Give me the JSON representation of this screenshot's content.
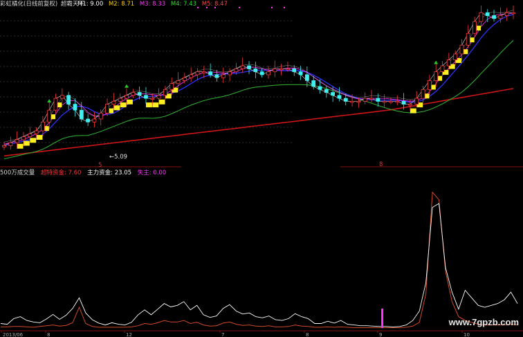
{
  "colors": {
    "background": "#000000",
    "bull_candle": "#ff3b3b",
    "bear_candle": "#3ff0f0",
    "yellow_band": "#ffee20",
    "ma1": "#ffffff",
    "ma2": "#ffd200",
    "ma3": "#ff33ff",
    "ma4": "#33dd33",
    "ma5": "#ff4444",
    "long_ma": "#d01515",
    "mid_ma": "#2fa82f",
    "blue_ma": "#3030ff",
    "capital_main": "#ffffff",
    "capital_super": "#d24a2a",
    "separator": "#8a1010",
    "magenta_bar": "#ff33ff",
    "arrow_icon": "#22cc22"
  },
  "top_panel": {
    "title": "彩虹橘化(日线前复权)",
    "indicator_name": "超霸天下",
    "mas": [
      {
        "label": "M1: 9.00",
        "color": "#ffffff"
      },
      {
        "label": "M2: 8.71",
        "color": "#ffd200"
      },
      {
        "label": "M3: 8.33",
        "color": "#ff33ff"
      },
      {
        "label": "M4: 7.43",
        "color": "#33dd33"
      },
      {
        "label": "M5: 8.47",
        "color": "#ff4444"
      }
    ],
    "low_annotation": "5.09",
    "marker_top": "5",
    "marker_right": "8"
  },
  "bottom_panel": {
    "title": "500万成交量",
    "legend": [
      {
        "label": "超特资金: 7.60",
        "color": "#ff3333"
      },
      {
        "label": "主力资金: 23.05",
        "color": "#ffffff"
      },
      {
        "label": "失主: 0.00",
        "color": "#ff33ff"
      }
    ]
  },
  "x_axis": {
    "labels": [
      "2013/06",
      "8",
      "12",
      "7",
      "8",
      "9",
      "10"
    ]
  },
  "watermark": "www.7gpzb.com",
  "chart_data": [
    {
      "type": "line",
      "title": "",
      "note": "candlestick price panel with moving averages (values estimated, price units)",
      "x": [
        0,
        1,
        2,
        3,
        4,
        5,
        6,
        7,
        8,
        9,
        10,
        11,
        12,
        13,
        14,
        15,
        16,
        17,
        18,
        19,
        20,
        21,
        22,
        23,
        24,
        25,
        26,
        27,
        28,
        29,
        30,
        31,
        32,
        33,
        34,
        35,
        36,
        37,
        38,
        39,
        40,
        41,
        42,
        43,
        44,
        45,
        46,
        47,
        48,
        49,
        50,
        51,
        52,
        53,
        54,
        55,
        56,
        57,
        58,
        59,
        60,
        61,
        62,
        63,
        64,
        65,
        66,
        67,
        68,
        69,
        70,
        71,
        72,
        73,
        74,
        75,
        76,
        77,
        78,
        79
      ],
      "ylim": [
        4.8,
        10.0
      ],
      "series": [
        {
          "name": "M1",
          "values": [
            5.4,
            5.5,
            5.6,
            5.7,
            5.8,
            5.9,
            6.2,
            6.6,
            7.0,
            7.1,
            6.8,
            6.6,
            6.3,
            6.2,
            6.3,
            6.5,
            6.8,
            6.9,
            7.0,
            7.1,
            7.2,
            7.1,
            7.0,
            7.0,
            7.1,
            7.3,
            7.5,
            7.6,
            7.7,
            7.8,
            7.9,
            7.9,
            7.8,
            7.7,
            7.8,
            7.9,
            8.0,
            8.1,
            8.0,
            7.9,
            7.8,
            7.9,
            8.0,
            8.0,
            8.0,
            7.9,
            7.8,
            7.6,
            7.4,
            7.3,
            7.2,
            7.1,
            7.0,
            6.9,
            6.9,
            6.9,
            7.0,
            7.0,
            6.9,
            6.9,
            6.9,
            6.9,
            6.8,
            6.8,
            7.0,
            7.3,
            7.6,
            7.9,
            8.1,
            8.3,
            8.5,
            8.8,
            9.2,
            9.6,
            9.9,
            9.8,
            9.7,
            9.8,
            9.9,
            9.9
          ]
        }
      ]
    },
    {
      "type": "line",
      "title": "",
      "note": "capital flow panel (values estimated)",
      "categories": [
        "2013/06",
        "8",
        "12",
        "7",
        "8",
        "9",
        "10"
      ],
      "ylim": [
        0,
        40
      ],
      "series": [
        {
          "name": "主力资金",
          "values": [
            1.2,
            1.0,
            2.5,
            3.0,
            2.0,
            1.6,
            1.4,
            2.4,
            3.6,
            2.3,
            3.4,
            5.2,
            8.0,
            4.0,
            2.2,
            1.3,
            0.8,
            1.4,
            1.0,
            0.8,
            1.5,
            3.5,
            4.8,
            3.5,
            5.0,
            6.5,
            5.6,
            6.0,
            7.0,
            4.8,
            6.0,
            3.5,
            2.8,
            3.2,
            5.2,
            6.2,
            4.5,
            3.7,
            4.0,
            3.0,
            2.7,
            3.2,
            2.2,
            2.0,
            2.5,
            3.8,
            3.0,
            2.5,
            1.2,
            1.2,
            1.8,
            1.3,
            2.0,
            1.0,
            0.8,
            0.6,
            0.6,
            0.5,
            0.4,
            0.4,
            0.3,
            0.4,
            0.8,
            2.0,
            4.5,
            12.0,
            32.0,
            33.0,
            16.0,
            9.5,
            5.0,
            10.0,
            8.0,
            6.0,
            5.5,
            6.0,
            6.5,
            7.5,
            9.5,
            6.5
          ]
        },
        {
          "name": "超特资金",
          "values": [
            0.3,
            0.3,
            0.4,
            0.4,
            0.3,
            0.2,
            0.4,
            0.6,
            0.8,
            0.5,
            0.7,
            1.4,
            5.5,
            1.2,
            0.4,
            0.2,
            0.2,
            0.2,
            0.2,
            0.2,
            0.3,
            0.6,
            1.2,
            1.0,
            1.4,
            2.0,
            1.6,
            1.6,
            2.0,
            1.2,
            1.5,
            0.8,
            0.5,
            0.6,
            1.3,
            1.6,
            1.0,
            0.7,
            0.8,
            0.5,
            0.4,
            0.6,
            0.3,
            0.3,
            0.4,
            0.8,
            0.5,
            0.4,
            0.2,
            0.2,
            0.3,
            0.2,
            0.3,
            0.2,
            0.1,
            0.1,
            0.1,
            0.1,
            0.1,
            0.1,
            0.1,
            0.1,
            0.2,
            0.5,
            1.5,
            9.0,
            36.0,
            34.0,
            15.0,
            7.0,
            3.0,
            2.0,
            1.5,
            1.0,
            0.8,
            0.8,
            0.8,
            0.8,
            1.0,
            0.8
          ]
        }
      ]
    }
  ]
}
